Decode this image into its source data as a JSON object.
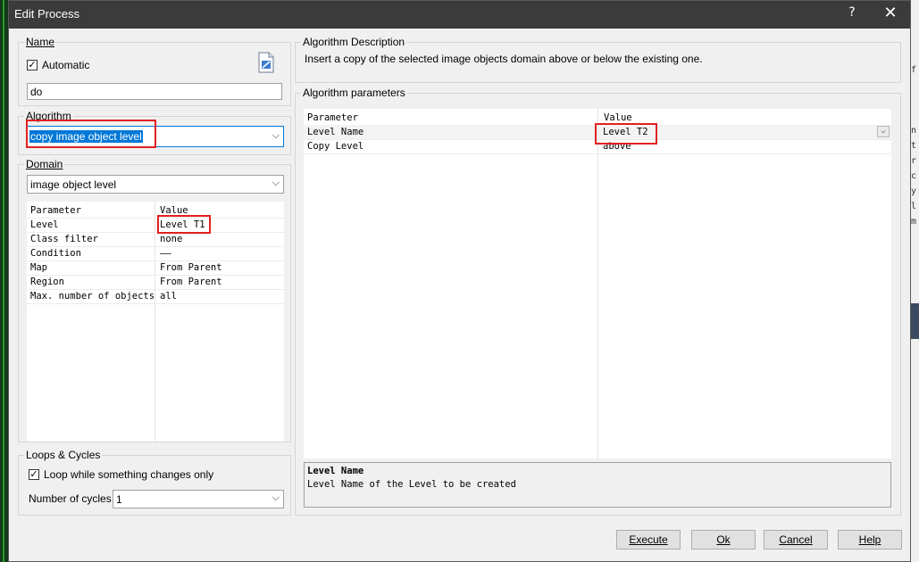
{
  "window": {
    "title": "Edit Process",
    "help": "?",
    "close": "✕"
  },
  "name_group": {
    "label": "Name",
    "automatic_label": "Automatic",
    "automatic_checked": true,
    "value": "do"
  },
  "algorithm_group": {
    "label": "Algorithm",
    "selected": "copy image object level"
  },
  "domain_group": {
    "label": "Domain",
    "selected": "image object level",
    "header": {
      "param": "Parameter",
      "value": "Value"
    },
    "rows": [
      {
        "param": "Level",
        "value": "Level T1"
      },
      {
        "param": "Class filter",
        "value": "none"
      },
      {
        "param": "Condition",
        "value": "——"
      },
      {
        "param": "Map",
        "value": "From Parent"
      },
      {
        "param": "Region",
        "value": "From Parent"
      },
      {
        "param": "Max. number of objects",
        "value": "all"
      }
    ]
  },
  "loops_group": {
    "label": "Loops & Cycles",
    "loop_label": "Loop while something changes only",
    "loop_checked": true,
    "cycles_label": "Number of cycles",
    "cycles_value": "1"
  },
  "description_group": {
    "label": "Algorithm Description",
    "text": "Insert a copy of the selected image objects domain above or below the existing one."
  },
  "params_group": {
    "label": "Algorithm parameters",
    "header": {
      "param": "Parameter",
      "value": "Value"
    },
    "rows": [
      {
        "param": "Level Name",
        "value": "Level T2"
      },
      {
        "param": "Copy Level",
        "value": "above"
      }
    ],
    "help_title": "Level Name",
    "help_text": "Level Name of the Level to be created"
  },
  "buttons": {
    "execute": "Execute",
    "ok": "Ok",
    "cancel": "Cancel",
    "help": "Help"
  },
  "colors": {
    "highlight": "#0078d7",
    "annotation": "#e02020",
    "titlebar": "#3b3b3b"
  }
}
